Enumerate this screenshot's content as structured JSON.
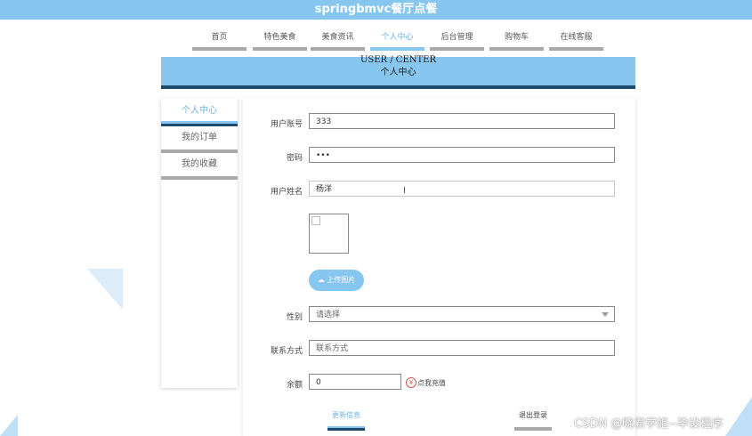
{
  "app": {
    "title": "springbmvc餐厅点餐"
  },
  "nav": {
    "items": [
      {
        "label": "首页"
      },
      {
        "label": "特色美食"
      },
      {
        "label": "美食资讯"
      },
      {
        "label": "个人中心"
      },
      {
        "label": "后台管理"
      },
      {
        "label": "购物车"
      },
      {
        "label": "在线客服"
      }
    ],
    "active": "个人中心"
  },
  "banner": {
    "en": "USER / CENTER",
    "cn": "个人中心"
  },
  "sidebar": {
    "items": [
      {
        "label": "个人中心"
      },
      {
        "label": "我的订单"
      },
      {
        "label": "我的收藏"
      }
    ]
  },
  "form": {
    "account": {
      "label": "用户账号",
      "value": "333"
    },
    "password": {
      "label": "密码",
      "value": "•••"
    },
    "name": {
      "label": "用户姓名",
      "value": "杨洋"
    },
    "upload_label": "上传图片",
    "gender": {
      "label": "性别",
      "placeholder": "请选择"
    },
    "contact": {
      "label": "联系方式",
      "placeholder": "联系方式"
    },
    "balance": {
      "label": "余额",
      "value": "0",
      "recharge": "点我充值"
    },
    "update_label": "更新信息",
    "logout_label": "退出登录"
  },
  "watermark": "CSDN @晓君学姐--毕设程序",
  "colors": {
    "primary": "#86c6ef",
    "dark": "#1f4a6b",
    "gray": "#a9a9a9"
  }
}
